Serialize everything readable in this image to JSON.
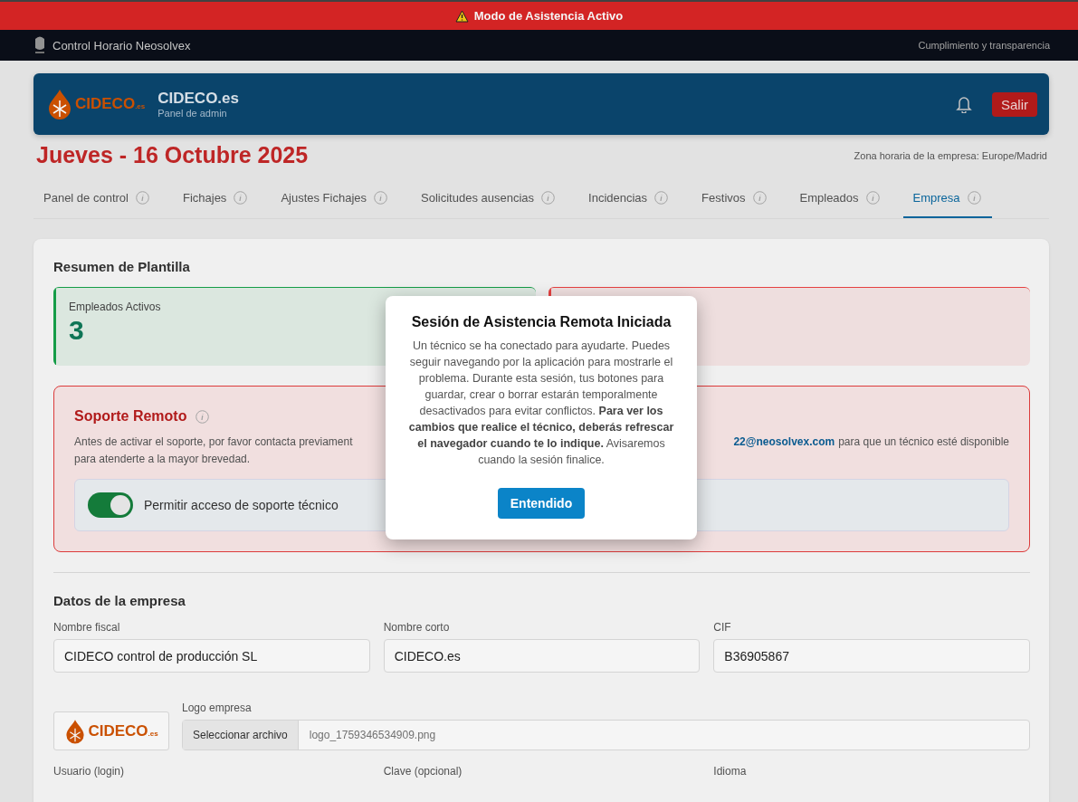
{
  "banner": {
    "text": "Modo de Asistencia Activo"
  },
  "topbar": {
    "title": "Control Horario Neosolvex",
    "tagline": "Cumplimiento y transparencia"
  },
  "header": {
    "logo_text": "CIDECO",
    "logo_suffix": ".es",
    "company": "CIDECO.es",
    "subtitle": "Panel de admin",
    "logout": "Salir"
  },
  "date": "Jueves - 16 Octubre 2025",
  "timezone": "Zona horaria de la empresa: Europe/Madrid",
  "tabs": [
    {
      "label": "Panel de control",
      "selected": false
    },
    {
      "label": "Fichajes",
      "selected": false
    },
    {
      "label": "Ajustes Fichajes",
      "selected": false
    },
    {
      "label": "Solicitudes ausencias",
      "selected": false
    },
    {
      "label": "Incidencias",
      "selected": false
    },
    {
      "label": "Festivos",
      "selected": false
    },
    {
      "label": "Empleados",
      "selected": false
    },
    {
      "label": "Empresa",
      "selected": true
    }
  ],
  "summary": {
    "title": "Resumen de Plantilla",
    "stats": [
      {
        "label": "Empleados Activos",
        "value": "3",
        "color": "#16a34a"
      },
      {
        "color": "#ef4444"
      }
    ]
  },
  "support": {
    "title": "Soporte Remoto",
    "text_left": "Antes de activar el soporte, por favor contacta previament",
    "email": "22@neosolvex.com",
    "text_right": "para que un técnico esté disponible",
    "text_line2": "para atenderte a la mayor brevedad.",
    "toggle": {
      "label": "Permitir acceso de soporte técnico",
      "on": true
    }
  },
  "company": {
    "title": "Datos de la empresa",
    "fields": [
      {
        "label": "Nombre fiscal",
        "value": "CIDECO control de producción SL"
      },
      {
        "label": "Nombre corto",
        "value": "CIDECO.es"
      },
      {
        "label": "CIF",
        "value": "B36905867"
      }
    ],
    "logo": {
      "logo_text": "CIDECO",
      "logo_suffix": ".es",
      "label": "Logo empresa",
      "button": "Seleccionar archivo",
      "file": "logo_1759346534909.png"
    },
    "more_labels": [
      "Usuario (login)",
      "Clave (opcional)",
      "Idioma"
    ]
  },
  "modal": {
    "title": "Sesión de Asistencia Remota Iniciada",
    "body": "Un técnico se ha conectado para ayudarte. Puedes seguir navegando por la aplicación para mostrarle el problema. Durante esta sesión, tus botones para guardar, crear o borrar estarán temporalmente desactivados para evitar conflictos. **Para ver los cambios que realice el técnico, deberás refrescar el navegador cuando te lo indique.** Avisaremos cuando la sesión finalice.",
    "button": "Entendido"
  }
}
